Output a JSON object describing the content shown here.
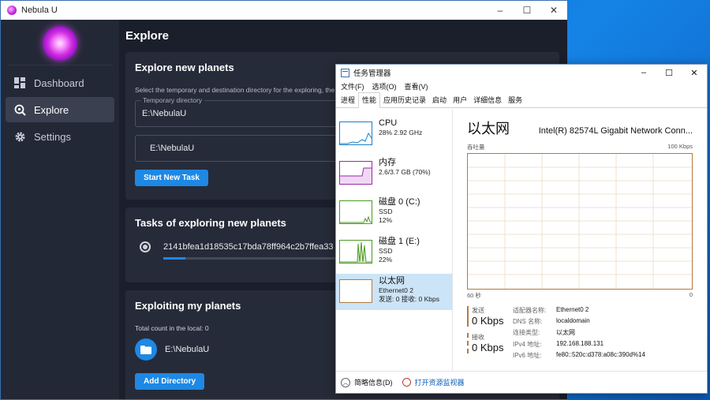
{
  "nebula": {
    "title": "Nebula U",
    "controls": [
      "–",
      "☐",
      "✕"
    ],
    "nav": [
      {
        "label": "Dashboard",
        "icon": "dashboard-icon"
      },
      {
        "label": "Explore",
        "icon": "explore-icon",
        "active": true
      },
      {
        "label": "Settings",
        "icon": "gear-icon"
      }
    ],
    "page_title": "Explore",
    "explore_card": {
      "title": "Explore new planets",
      "description": "Select the temporary and destination directory for the exploring, the",
      "temp_label": "Temporary directory",
      "temp_value": "E:\\NebulaU",
      "dest_value": "E:\\NebulaU",
      "button": "Start New Task"
    },
    "tasks_card": {
      "title": "Tasks of exploring new planets",
      "task_hash": "2141bfea1d18535c17bda78ff964c2b7ffea33",
      "progress": 0.12
    },
    "exploit_card": {
      "title": "Exploiting my planets",
      "count_text": "Total count in the local: 0",
      "folder": "E:\\NebulaU",
      "button": "Add Directory"
    }
  },
  "taskmgr": {
    "title": "任务管理器",
    "controls": [
      "–",
      "☐",
      "✕"
    ],
    "menu": [
      "文件(F)",
      "选项(O)",
      "查看(V)"
    ],
    "tabs": [
      "进程",
      "性能",
      "应用历史记录",
      "启动",
      "用户",
      "详细信息",
      "服务"
    ],
    "active_tab": 1,
    "items": [
      {
        "name": "CPU",
        "sub1": "28% 2.92 GHz",
        "sub2": "",
        "color": "#1a80c8"
      },
      {
        "name": "内存",
        "sub1": "2.6/3.7 GB (70%)",
        "sub2": "",
        "color": "#9a2aa8"
      },
      {
        "name": "磁盘 0 (C:)",
        "sub1": "SSD",
        "sub2": "12%",
        "color": "#4c9a22"
      },
      {
        "name": "磁盘 1 (E:)",
        "sub1": "SSD",
        "sub2": "22%",
        "color": "#4c9a22"
      },
      {
        "name": "以太网",
        "sub1": "Ethernet0 2",
        "sub2": "发送: 0 接收: 0 Kbps",
        "color": "#b47a3e",
        "selected": true
      }
    ],
    "detail": {
      "heading": "以太网",
      "adapter": "Intel(R) 82574L Gigabit Network Conn...",
      "graph_label_left": "吞吐量",
      "graph_label_right": "100 Kbps",
      "axis_left": "60 秒",
      "axis_right": "0",
      "send_label": "发送",
      "send_value": "0 Kbps",
      "recv_label": "接收",
      "recv_value": "0 Kbps",
      "props": [
        {
          "k": "适配器名称:",
          "v": "Ethernet0 2"
        },
        {
          "k": "DNS 名称:",
          "v": "localdomain"
        },
        {
          "k": "连接类型:",
          "v": "以太网"
        },
        {
          "k": "IPv4 地址:",
          "v": "192.168.188.131"
        },
        {
          "k": "IPv6 地址:",
          "v": "fe80::520c:d378:a08c:390d%14"
        }
      ]
    },
    "footer": {
      "brief": "简略信息(D)",
      "monitor": "打开资源监视器"
    }
  }
}
